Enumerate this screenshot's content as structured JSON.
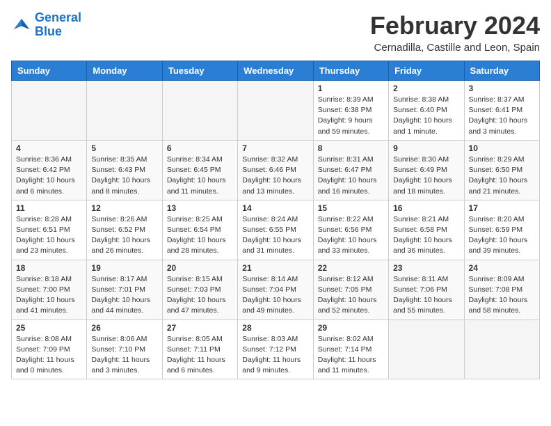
{
  "header": {
    "logo_line1": "General",
    "logo_line2": "Blue",
    "month_title": "February 2024",
    "location": "Cernadilla, Castille and Leon, Spain"
  },
  "weekdays": [
    "Sunday",
    "Monday",
    "Tuesday",
    "Wednesday",
    "Thursday",
    "Friday",
    "Saturday"
  ],
  "weeks": [
    [
      {
        "day": "",
        "info": ""
      },
      {
        "day": "",
        "info": ""
      },
      {
        "day": "",
        "info": ""
      },
      {
        "day": "",
        "info": ""
      },
      {
        "day": "1",
        "info": "Sunrise: 8:39 AM\nSunset: 6:38 PM\nDaylight: 9 hours\nand 59 minutes."
      },
      {
        "day": "2",
        "info": "Sunrise: 8:38 AM\nSunset: 6:40 PM\nDaylight: 10 hours\nand 1 minute."
      },
      {
        "day": "3",
        "info": "Sunrise: 8:37 AM\nSunset: 6:41 PM\nDaylight: 10 hours\nand 3 minutes."
      }
    ],
    [
      {
        "day": "4",
        "info": "Sunrise: 8:36 AM\nSunset: 6:42 PM\nDaylight: 10 hours\nand 6 minutes."
      },
      {
        "day": "5",
        "info": "Sunrise: 8:35 AM\nSunset: 6:43 PM\nDaylight: 10 hours\nand 8 minutes."
      },
      {
        "day": "6",
        "info": "Sunrise: 8:34 AM\nSunset: 6:45 PM\nDaylight: 10 hours\nand 11 minutes."
      },
      {
        "day": "7",
        "info": "Sunrise: 8:32 AM\nSunset: 6:46 PM\nDaylight: 10 hours\nand 13 minutes."
      },
      {
        "day": "8",
        "info": "Sunrise: 8:31 AM\nSunset: 6:47 PM\nDaylight: 10 hours\nand 16 minutes."
      },
      {
        "day": "9",
        "info": "Sunrise: 8:30 AM\nSunset: 6:49 PM\nDaylight: 10 hours\nand 18 minutes."
      },
      {
        "day": "10",
        "info": "Sunrise: 8:29 AM\nSunset: 6:50 PM\nDaylight: 10 hours\nand 21 minutes."
      }
    ],
    [
      {
        "day": "11",
        "info": "Sunrise: 8:28 AM\nSunset: 6:51 PM\nDaylight: 10 hours\nand 23 minutes."
      },
      {
        "day": "12",
        "info": "Sunrise: 8:26 AM\nSunset: 6:52 PM\nDaylight: 10 hours\nand 26 minutes."
      },
      {
        "day": "13",
        "info": "Sunrise: 8:25 AM\nSunset: 6:54 PM\nDaylight: 10 hours\nand 28 minutes."
      },
      {
        "day": "14",
        "info": "Sunrise: 8:24 AM\nSunset: 6:55 PM\nDaylight: 10 hours\nand 31 minutes."
      },
      {
        "day": "15",
        "info": "Sunrise: 8:22 AM\nSunset: 6:56 PM\nDaylight: 10 hours\nand 33 minutes."
      },
      {
        "day": "16",
        "info": "Sunrise: 8:21 AM\nSunset: 6:58 PM\nDaylight: 10 hours\nand 36 minutes."
      },
      {
        "day": "17",
        "info": "Sunrise: 8:20 AM\nSunset: 6:59 PM\nDaylight: 10 hours\nand 39 minutes."
      }
    ],
    [
      {
        "day": "18",
        "info": "Sunrise: 8:18 AM\nSunset: 7:00 PM\nDaylight: 10 hours\nand 41 minutes."
      },
      {
        "day": "19",
        "info": "Sunrise: 8:17 AM\nSunset: 7:01 PM\nDaylight: 10 hours\nand 44 minutes."
      },
      {
        "day": "20",
        "info": "Sunrise: 8:15 AM\nSunset: 7:03 PM\nDaylight: 10 hours\nand 47 minutes."
      },
      {
        "day": "21",
        "info": "Sunrise: 8:14 AM\nSunset: 7:04 PM\nDaylight: 10 hours\nand 49 minutes."
      },
      {
        "day": "22",
        "info": "Sunrise: 8:12 AM\nSunset: 7:05 PM\nDaylight: 10 hours\nand 52 minutes."
      },
      {
        "day": "23",
        "info": "Sunrise: 8:11 AM\nSunset: 7:06 PM\nDaylight: 10 hours\nand 55 minutes."
      },
      {
        "day": "24",
        "info": "Sunrise: 8:09 AM\nSunset: 7:08 PM\nDaylight: 10 hours\nand 58 minutes."
      }
    ],
    [
      {
        "day": "25",
        "info": "Sunrise: 8:08 AM\nSunset: 7:09 PM\nDaylight: 11 hours\nand 0 minutes."
      },
      {
        "day": "26",
        "info": "Sunrise: 8:06 AM\nSunset: 7:10 PM\nDaylight: 11 hours\nand 3 minutes."
      },
      {
        "day": "27",
        "info": "Sunrise: 8:05 AM\nSunset: 7:11 PM\nDaylight: 11 hours\nand 6 minutes."
      },
      {
        "day": "28",
        "info": "Sunrise: 8:03 AM\nSunset: 7:12 PM\nDaylight: 11 hours\nand 9 minutes."
      },
      {
        "day": "29",
        "info": "Sunrise: 8:02 AM\nSunset: 7:14 PM\nDaylight: 11 hours\nand 11 minutes."
      },
      {
        "day": "",
        "info": ""
      },
      {
        "day": "",
        "info": ""
      }
    ]
  ]
}
